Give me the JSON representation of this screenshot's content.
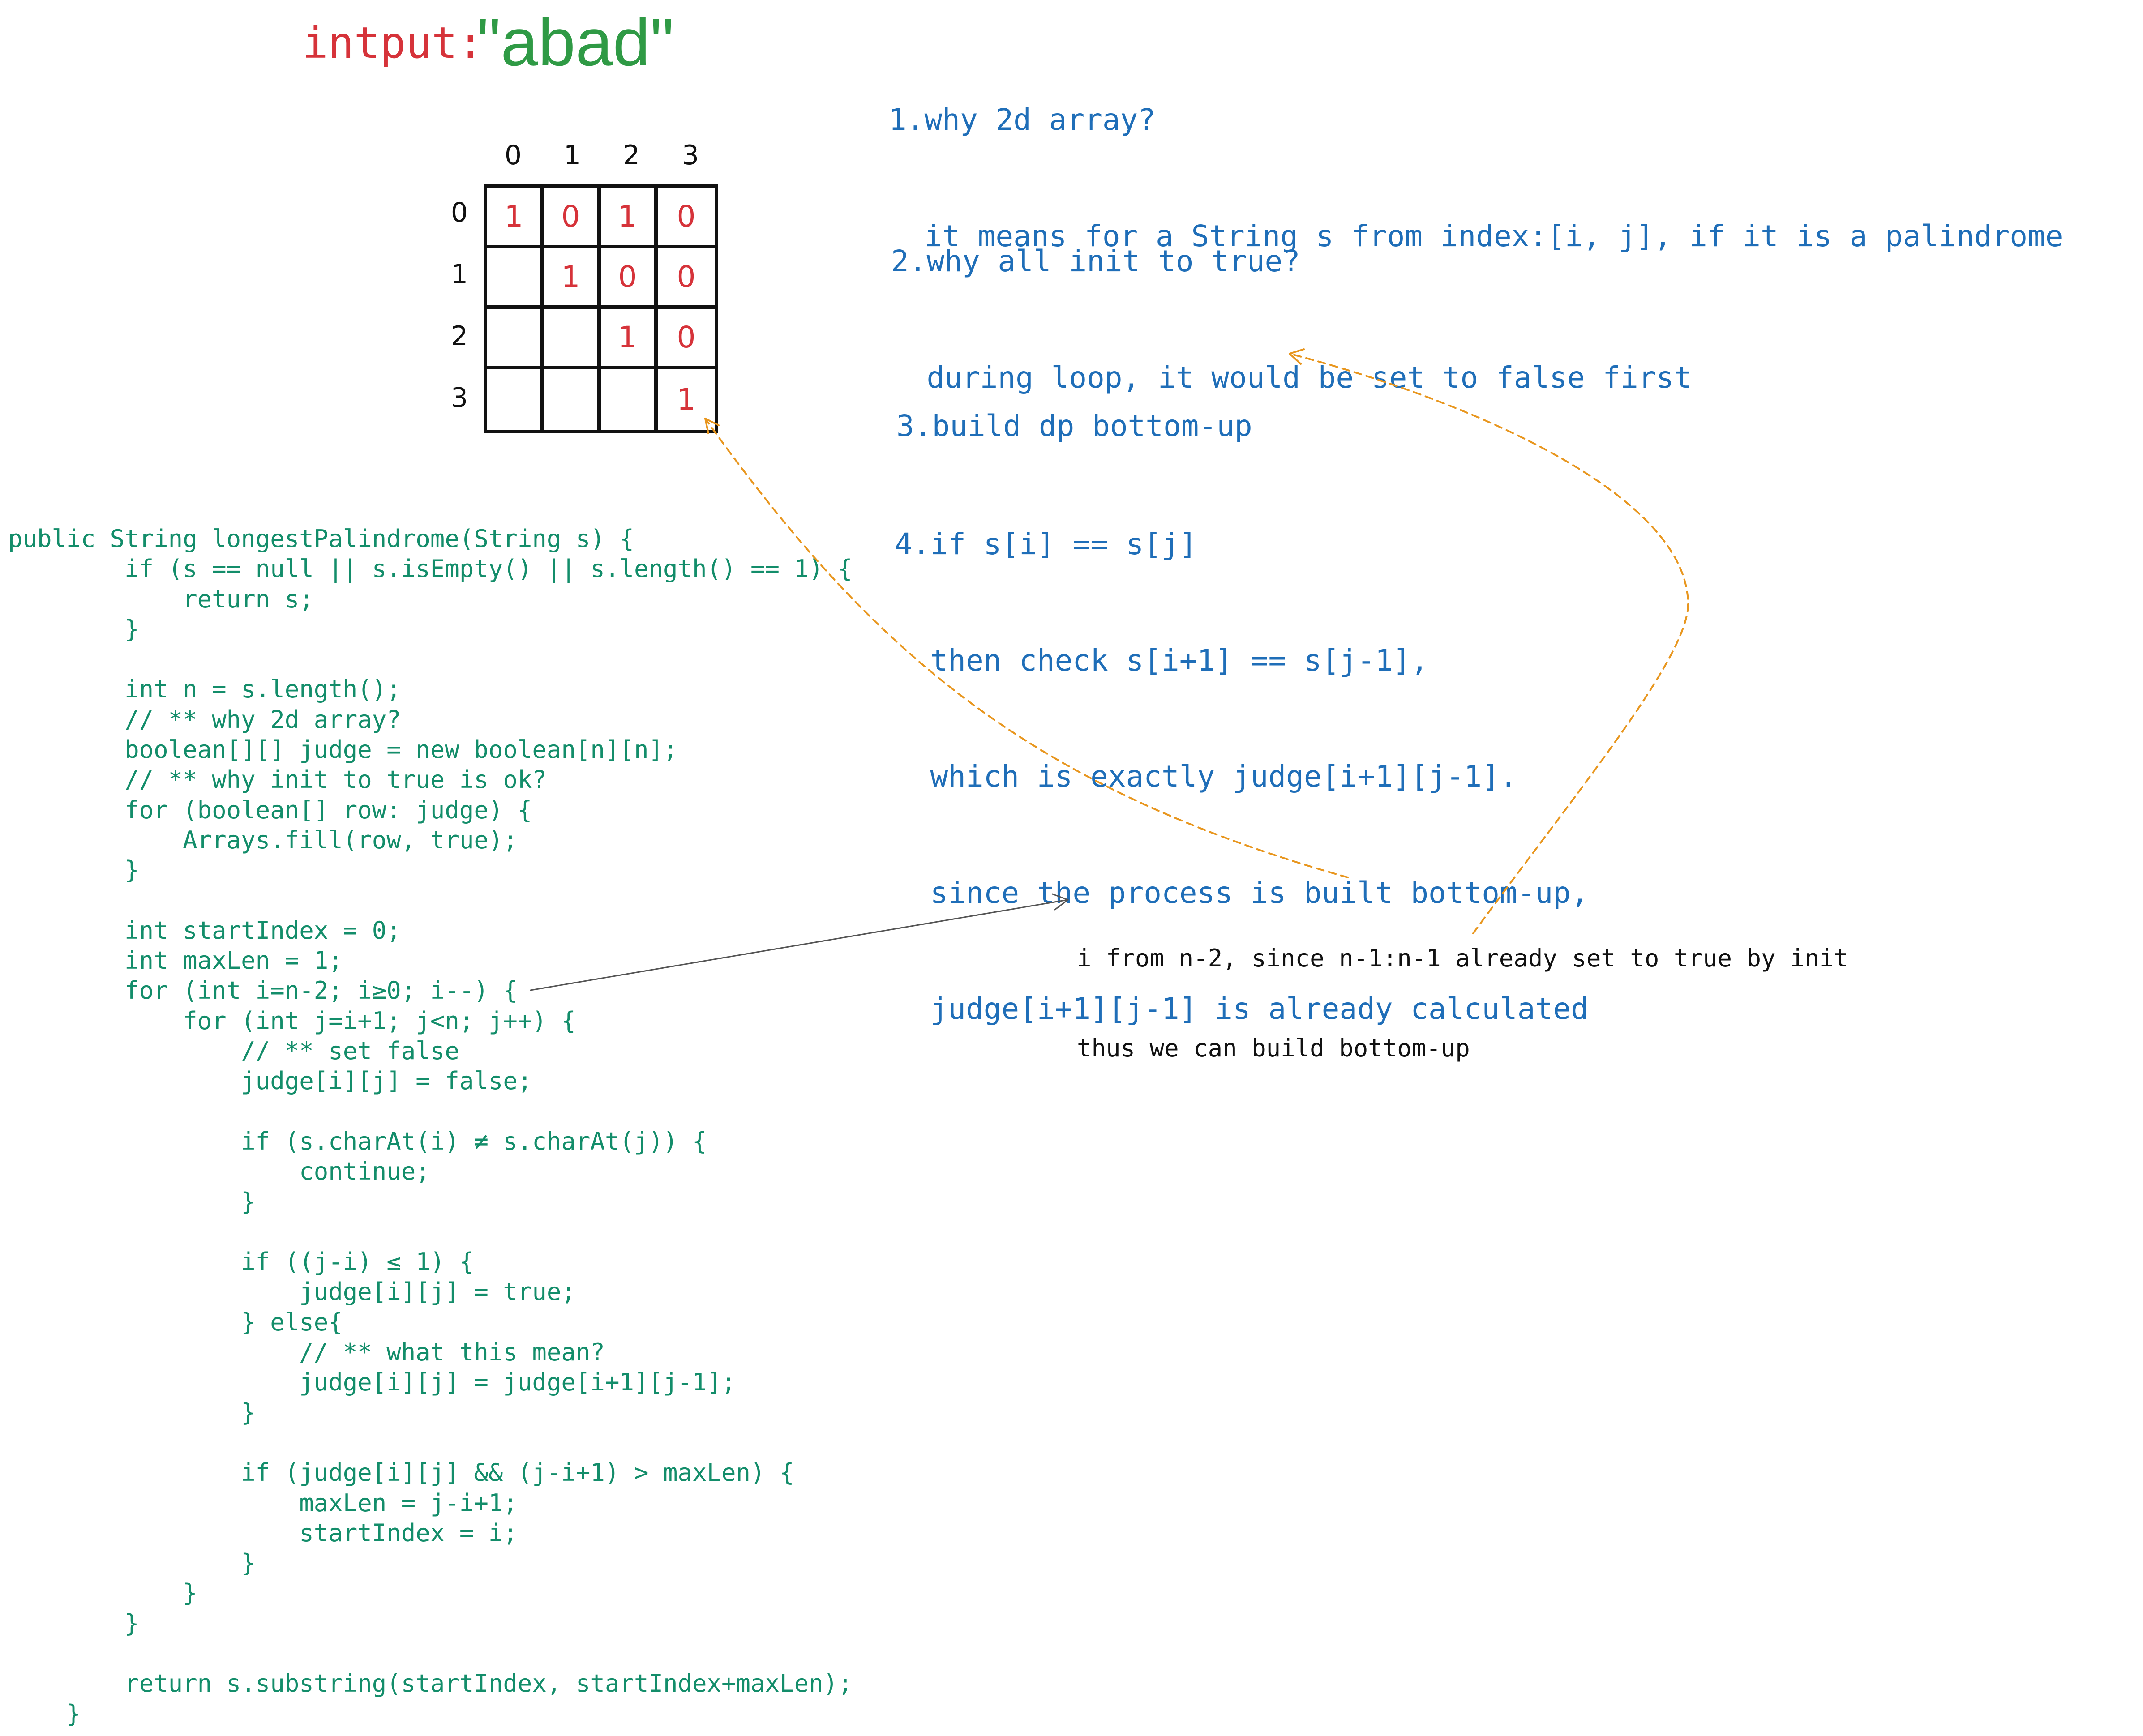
{
  "title": {
    "label": "intput:",
    "value": "\"abad\""
  },
  "matrix": {
    "col_headers": [
      "0",
      "1",
      "2",
      "3"
    ],
    "row_headers": [
      "0",
      "1",
      "2",
      "3"
    ],
    "rows": [
      [
        "1",
        "0",
        "1",
        "0"
      ],
      [
        "",
        "1",
        "0",
        "0"
      ],
      [
        "",
        "",
        "1",
        "0"
      ],
      [
        "",
        "",
        "",
        "1"
      ]
    ]
  },
  "code_lines": [
    "public String longestPalindrome(String s) {",
    "        if (s == null || s.isEmpty() || s.length() == 1) {",
    "            return s;",
    "        }",
    "",
    "        int n = s.length();",
    "        // ** why 2d array?",
    "        boolean[][] judge = new boolean[n][n];",
    "        // ** why init to true is ok?",
    "        for (boolean[] row: judge) {",
    "            Arrays.fill(row, true);",
    "        }",
    "",
    "        int startIndex = 0;",
    "        int maxLen = 1;",
    "        for (int i=n-2; i≥0; i--) {",
    "            for (int j=i+1; j<n; j++) {",
    "                // ** set false",
    "                judge[i][j] = false;",
    "",
    "                if (s.charAt(i) ≠ s.charAt(j)) {",
    "                    continue;",
    "                }",
    "",
    "                if ((j-i) ≤ 1) {",
    "                    judge[i][j] = true;",
    "                } else{",
    "                    // ** what this mean?",
    "                    judge[i][j] = judge[i+1][j-1];",
    "                }",
    "",
    "                if (judge[i][j] && (j-i+1) > maxLen) {",
    "                    maxLen = j-i+1;",
    "                    startIndex = i;",
    "                }",
    "            }",
    "        }",
    "",
    "        return s.substring(startIndex, startIndex+maxLen);",
    "    }"
  ],
  "notes": [
    {
      "lines": [
        "1.why 2d array?",
        "  it means for a String s from index:[i, j], if it is a palindrome"
      ]
    },
    {
      "lines": [
        "2.why all init to true?",
        "  during loop, it would be set to false first"
      ]
    },
    {
      "lines": [
        "3.build dp bottom-up"
      ]
    },
    {
      "lines": [
        "4.if s[i] == s[j]",
        "  then check s[i+1] == s[j-1],",
        "  which is exactly judge[i+1][j-1].",
        "  since the process is built bottom-up,",
        "  judge[i+1][j-1] is already calculated"
      ]
    }
  ],
  "annotation": {
    "lines": [
      "i from n-2, since n-1:n-1 already set to true by init",
      "thus we can build bottom-up"
    ]
  },
  "colors": {
    "title_label": "#d6333a",
    "title_value": "#2f9a45",
    "matrix_values": "#d6333a",
    "code": "#138d6a",
    "notes": "#1f6eb8",
    "annotation": "#111111",
    "dashed_arrows": "#e8961e",
    "solid_arrow": "#555555"
  }
}
